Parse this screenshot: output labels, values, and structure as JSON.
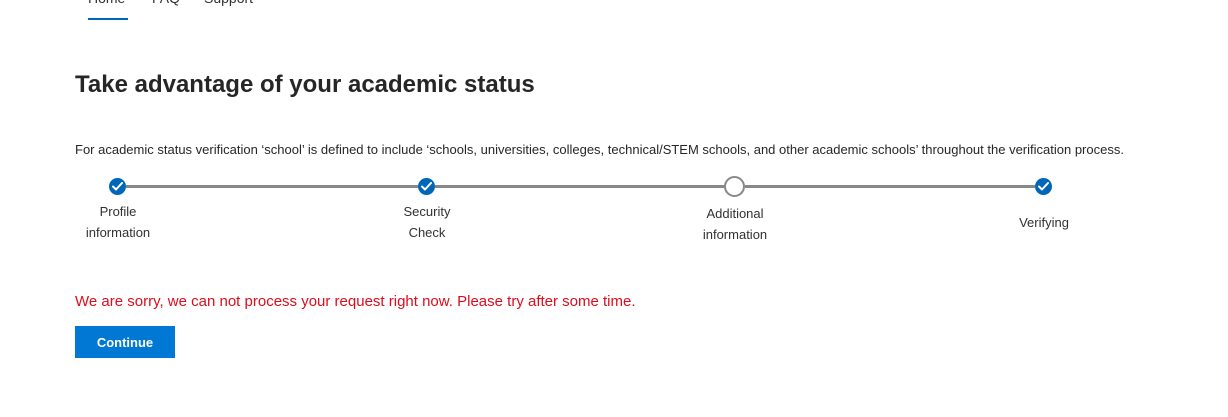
{
  "nav": {
    "items": [
      {
        "label": "Home",
        "active": true
      },
      {
        "label": "FAQ",
        "active": false
      },
      {
        "label": "Support",
        "active": false
      }
    ]
  },
  "page": {
    "title": "Take advantage of your academic status",
    "definition": "For academic status verification ‘school’ is defined to include ‘schools, universities, colleges, technical/STEM schools, and other academic schools’ throughout the verification process."
  },
  "stepper": {
    "steps": [
      {
        "label_line1": "Profile",
        "label_line2": "information",
        "state": "complete"
      },
      {
        "label_line1": "Security",
        "label_line2": "Check",
        "state": "complete"
      },
      {
        "label_line1": "Additional",
        "label_line2": "information",
        "state": "pending"
      },
      {
        "label_line1": "Verifying",
        "label_line2": "",
        "state": "complete"
      }
    ]
  },
  "error": {
    "message": "We are sorry, we can not process your request right now. Please try after some time."
  },
  "actions": {
    "continue_label": "Continue"
  },
  "colors": {
    "accent": "#0078d4",
    "step_complete": "#0067b8",
    "error": "#e00b1c",
    "line": "#8a8886"
  }
}
